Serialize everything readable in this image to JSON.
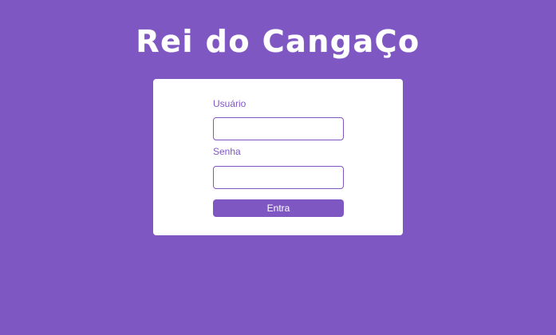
{
  "page": {
    "title": "Rei do CangaÇo"
  },
  "login_form": {
    "username_label": "Usuário",
    "username_value": "",
    "password_label": "Senha",
    "password_value": "",
    "submit_label": "Entra"
  },
  "colors": {
    "background": "#7f57c3",
    "card": "#ffffff",
    "accent": "#7f57c3",
    "title_text": "#ffffff"
  }
}
